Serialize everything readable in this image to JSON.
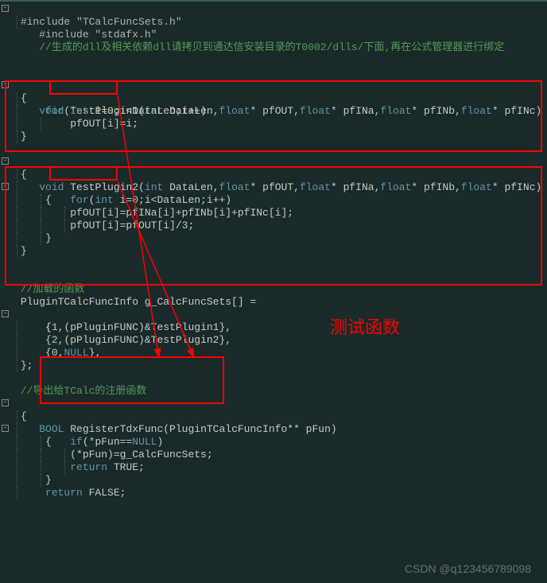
{
  "includes": {
    "inc1": "#include \"stdafx.h\"",
    "inc2": "#include \"TCalcFuncSets.h\""
  },
  "comments": {
    "c1": "//生成的dll及相关依赖dll请拷贝到通达信安装目录的T0002/dlls/下面,再在公式管理器进行绑定",
    "c2": "//加载的函数",
    "c3": "//导出给TCalc的注册函数"
  },
  "func1": {
    "ret": "void",
    "name": "TestPlugin1",
    "params_open": "(",
    "p_int": "int",
    "p_datalen": " DataLen,",
    "p_float": "float",
    "p_star": "*",
    "p_pfout": " pfOUT,",
    "p_pfina": " pfINa,",
    "p_pfinb": " pfINb,",
    "p_pfinc": " pfINc)",
    "lbrace": "{",
    "for_kw": "for",
    "for_cond_a": "(",
    "for_int": "int",
    "for_cond_b": " i=",
    "for_zero": "0",
    "for_cond_c": ";i<DataLen;i++)",
    "body": "        pfOUT[i]=i;",
    "rbrace": "}"
  },
  "func2": {
    "ret": "void",
    "name": "TestPlugin2",
    "params_open": "(",
    "p_int": "int",
    "p_datalen": " DataLen,",
    "p_float": "float",
    "p_star": "*",
    "p_pfout": " pfOUT,",
    "p_pfina": " pfINa,",
    "p_pfinb": " pfINb,",
    "p_pfinc": " pfINc)",
    "lbrace": "{",
    "for_kw": "for",
    "for_cond_a": "(",
    "for_int": "int",
    "for_cond_b": " i=",
    "for_zero": "0",
    "for_cond_c": ";i<DataLen;i++)",
    "inner_l": "    {",
    "body1": "        pfOUT[i]=pfINa[i]+pfINb[i]+pfINc[i];",
    "body2": "        pfOUT[i]=pfOUT[i]/",
    "body2_num": "3",
    "body2_end": ";",
    "inner_r": "    }",
    "rbrace": "}"
  },
  "array": {
    "decl_a": "PluginTCalcFuncInfo g_CalcFuncSets[] =",
    "lbrace": "{",
    "e1_a": "    {",
    "e1_num": "1",
    "e1_b": ",(pPluginFUNC)&TestPlugin1},",
    "e2_a": "    {",
    "e2_num": "2",
    "e2_b": ",(pPluginFUNC)&TestPlugin2},",
    "e3_a": "    {",
    "e3_num": "0",
    "e3_b": ",",
    "e3_null": "NULL",
    "e3_c": "},",
    "rbrace": "};"
  },
  "regfunc": {
    "ret": "BOOL",
    "name": " RegisterTdxFunc(PluginTCalcFuncInfo** pFun)",
    "lbrace": "{",
    "if_kw": "if",
    "if_cond": "(*pFun==",
    "if_null": "NULL",
    "if_end": ")",
    "inner_l": "    {",
    "body1": "        (*pFun)=g_CalcFuncSets;",
    "ret_kw": "return",
    "ret_true": " TRUE",
    "ret_semi": ";",
    "inner_r": "    }",
    "ret2_kw": "return",
    "ret2_false": " FALSE",
    "ret2_semi": ";"
  },
  "annotation": {
    "label": "测试函数"
  },
  "watermark": "CSDN @q123456789098",
  "colors": {
    "bg": "#1a2a2a",
    "keyword": "#6495a8",
    "comment": "#579957",
    "number": "#b5cea8",
    "highlight": "#ff0000"
  }
}
